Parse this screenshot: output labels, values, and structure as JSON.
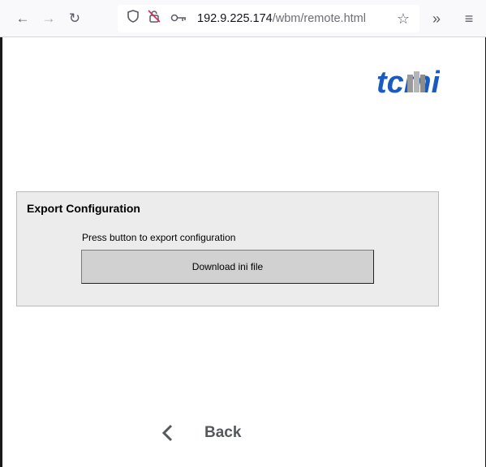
{
  "browser": {
    "url_host": "192.9.225.174",
    "url_path": "/wbm/remote.html",
    "icons": [
      "back-arrow-icon",
      "forward-arrow-icon",
      "reload-icon",
      "shield-icon",
      "permissions-icon",
      "key-icon",
      "star-icon",
      "overflow-icon",
      "menu-icon"
    ]
  },
  "logo": {
    "text": "tcmi",
    "color": "#1a5bbf"
  },
  "export": {
    "title": "Export Configuration",
    "instruction": "Press button to export configuration",
    "button_label": "Download ini file"
  },
  "nav": {
    "back_label": "Back"
  },
  "colors": {
    "panel_bg": "#ececec",
    "button_bg": "#d1d1d1",
    "accent": "#1a5bbf"
  }
}
